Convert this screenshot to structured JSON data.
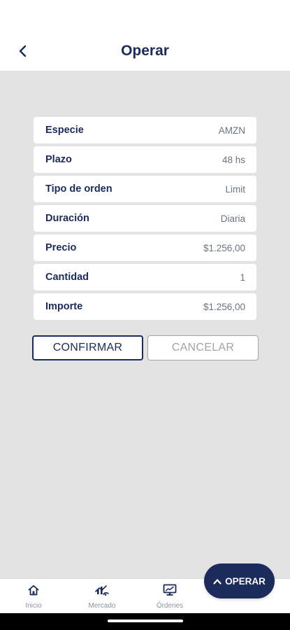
{
  "header": {
    "title": "Operar"
  },
  "order": {
    "rows": [
      {
        "label": "Especie",
        "value": "AMZN"
      },
      {
        "label": "Plazo",
        "value": "48 hs"
      },
      {
        "label": "Tipo de orden",
        "value": "Limit"
      },
      {
        "label": "Duración",
        "value": "Diaria"
      },
      {
        "label": "Precio",
        "value": "$1.256,00"
      },
      {
        "label": "Cantidad",
        "value": "1"
      },
      {
        "label": "Importe",
        "value": "$1.256,00"
      }
    ]
  },
  "actions": {
    "confirm_label": "CONFIRMAR",
    "cancel_label": "CANCELAR"
  },
  "nav": {
    "items": [
      {
        "label": "Inicio",
        "icon": "home-icon"
      },
      {
        "label": "Mercado",
        "icon": "market-icon"
      },
      {
        "label": "Órdenes",
        "icon": "orders-icon"
      }
    ]
  },
  "fab": {
    "label": "OPERAR",
    "icon": "chevron-up-icon"
  },
  "colors": {
    "primary": "#1b2b5b",
    "background": "#e3e3e3",
    "card": "#ffffff",
    "muted_text": "#6c7385",
    "disabled": "#a4a4a4"
  }
}
